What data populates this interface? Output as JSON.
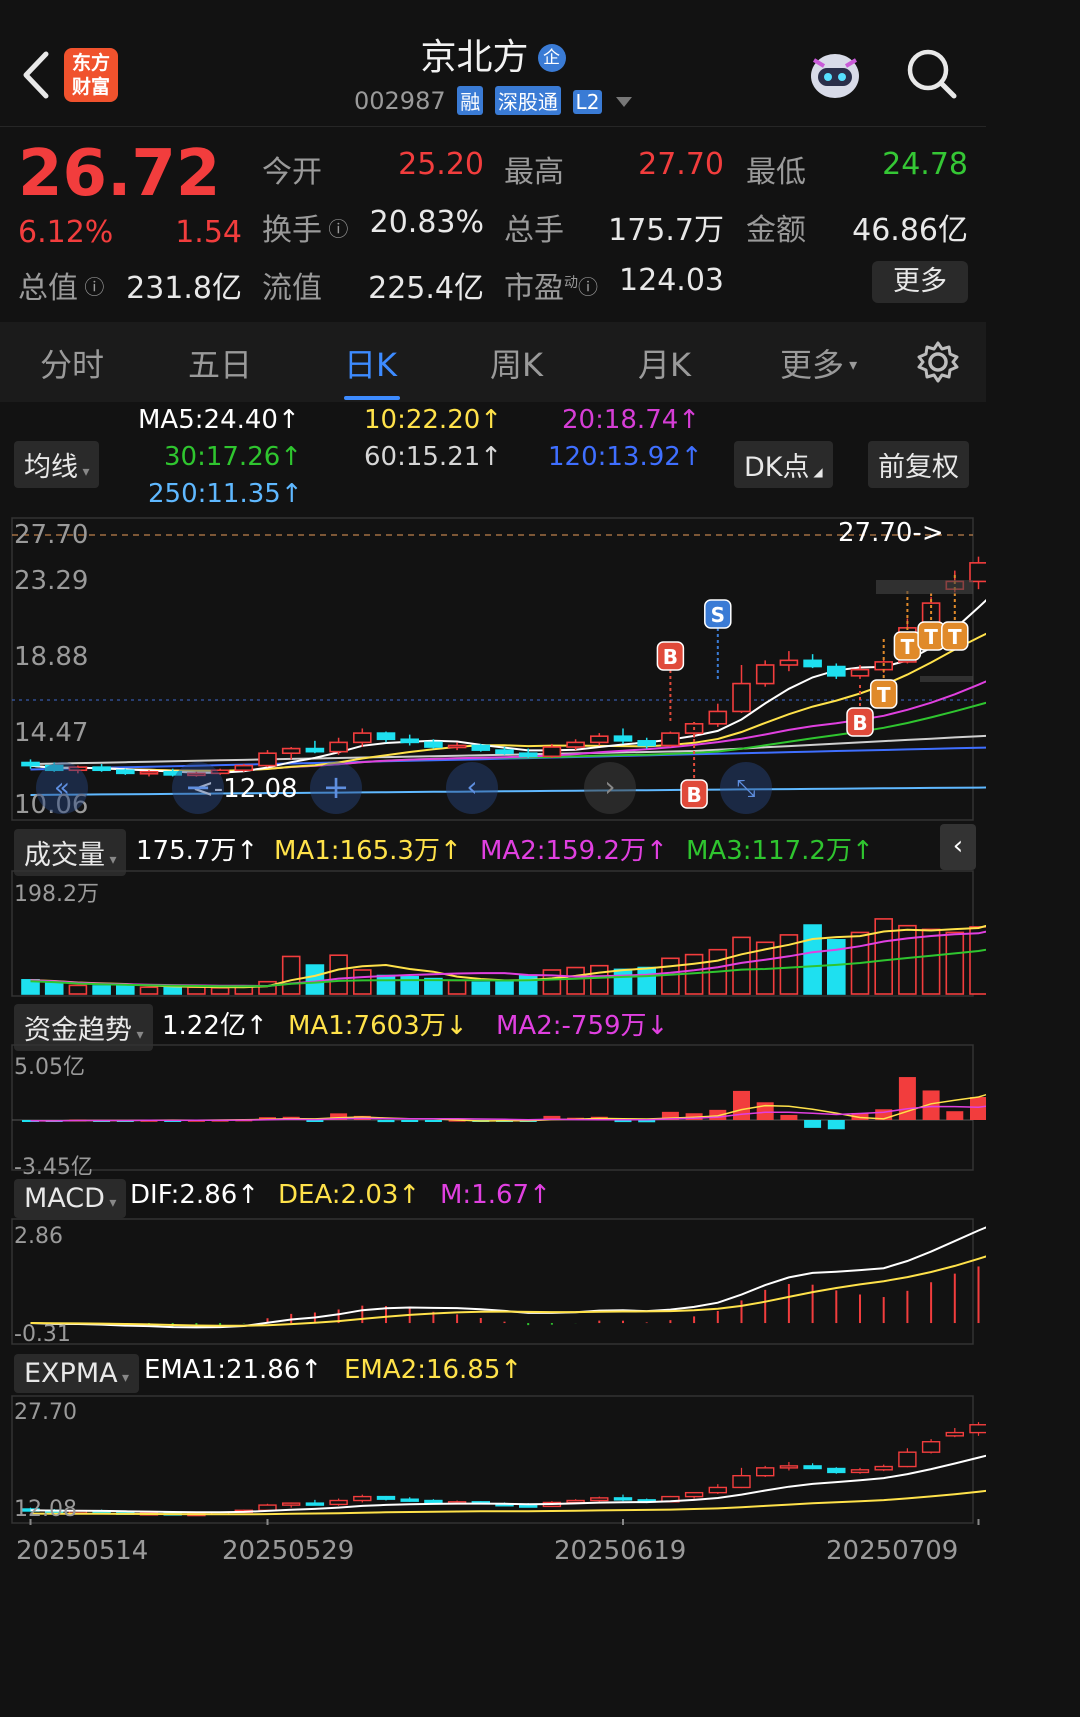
{
  "header": {
    "back_icon": "chevron-left-icon",
    "logo_text_line1": "东方",
    "logo_text_line2": "财富",
    "stock_name": "京北方",
    "company_badge": "企",
    "stock_code": "002987",
    "tags": [
      "融",
      "深股通",
      "L2"
    ],
    "robot_icon": "robot-avatar-icon",
    "search_icon": "search-icon"
  },
  "quote": {
    "price": "26.72",
    "change_pct": "6.12%",
    "change_amt": "1.54",
    "fields": {
      "open_label": "今开",
      "open": "25.20",
      "high_label": "最高",
      "high": "27.70",
      "low_label": "最低",
      "low": "24.78",
      "turnover_label": "换手",
      "turnover": "20.83%",
      "volume_label": "总手",
      "volume": "175.7万",
      "amount_label": "金额",
      "amount": "46.86亿",
      "mcap_label": "总值",
      "mcap": "231.8亿",
      "float_label": "流值",
      "float": "225.4亿",
      "pe_label": "市盈",
      "pe_sup": "动",
      "pe": "124.03"
    },
    "more_button": "更多"
  },
  "tabs": [
    "分时",
    "五日",
    "日K",
    "周K",
    "月K",
    "更多"
  ],
  "active_tab": "日K",
  "kline": {
    "indicator_select": "均线",
    "ma": {
      "ma5": "MA5:24.40↑",
      "ma10": "10:22.20↑",
      "ma20": "20:18.74↑",
      "ma30": "30:17.26↑",
      "ma60": "60:15.21↑",
      "ma120": "120:13.92↑",
      "ma250": "250:11.35↑"
    },
    "dk_button": "DK点",
    "adjust_button": "前复权",
    "yticks": [
      "27.70",
      "23.29",
      "18.88",
      "14.47",
      "10.06"
    ],
    "high_annotation": "27.70->",
    "low_annotation": "<-12.08",
    "markers": [
      "B",
      "S",
      "T"
    ]
  },
  "volume": {
    "label": "成交量",
    "value": "175.7万↑",
    "ma1": "MA1:165.3万↑",
    "ma2": "MA2:159.2万↑",
    "ma3": "MA3:117.2万↑",
    "ytick": "198.2万"
  },
  "fund": {
    "label": "资金趋势",
    "value": "1.22亿↑",
    "ma1": "MA1:7603万↓",
    "ma2": "MA2:-759万↓",
    "ytick_top": "5.05亿",
    "ytick_bottom": "-3.45亿"
  },
  "macd": {
    "label": "MACD",
    "dif": "DIF:2.86↑",
    "dea": "DEA:2.03↑",
    "m": "M:1.67↑",
    "ytick_top": "2.86",
    "ytick_bottom": "-0.31"
  },
  "expma": {
    "label": "EXPMA",
    "ema1": "EMA1:21.86↑",
    "ema2": "EMA2:16.85↑",
    "ytick_top": "27.70",
    "ytick_bottom": "12.08"
  },
  "dates": [
    "20250514",
    "20250529",
    "20250619",
    "20250709"
  ],
  "colors": {
    "up": "#f23d3d",
    "down": "#1ee0f0",
    "ma5": "#ffffff",
    "ma10": "#ffe24a",
    "ma20": "#e040e0",
    "ma30": "#2fc52f",
    "ma60": "#cfcfcf",
    "ma120": "#3f6fff",
    "ma250": "#5fb8ff",
    "accent": "#3d8bff"
  },
  "chart_data": {
    "type": "candlestick",
    "title": "",
    "note": "Daily K-line (approximate OHLC read from chart, data units = price)",
    "ylim": [
      10.06,
      27.7
    ],
    "candles": [
      {
        "o": 13.0,
        "h": 13.2,
        "l": 12.6,
        "c": 12.8
      },
      {
        "o": 12.8,
        "h": 13.0,
        "l": 12.4,
        "c": 12.5
      },
      {
        "o": 12.5,
        "h": 12.8,
        "l": 12.3,
        "c": 12.7
      },
      {
        "o": 12.7,
        "h": 12.9,
        "l": 12.4,
        "c": 12.5
      },
      {
        "o": 12.5,
        "h": 12.6,
        "l": 12.2,
        "c": 12.3
      },
      {
        "o": 12.3,
        "h": 12.5,
        "l": 12.1,
        "c": 12.4
      },
      {
        "o": 12.4,
        "h": 12.6,
        "l": 12.1,
        "c": 12.2
      },
      {
        "o": 12.2,
        "h": 12.4,
        "l": 12.08,
        "c": 12.3
      },
      {
        "o": 12.3,
        "h": 12.6,
        "l": 12.2,
        "c": 12.5
      },
      {
        "o": 12.5,
        "h": 12.9,
        "l": 12.4,
        "c": 12.8
      },
      {
        "o": 12.8,
        "h": 13.8,
        "l": 12.7,
        "c": 13.6
      },
      {
        "o": 13.6,
        "h": 14.0,
        "l": 13.2,
        "c": 13.9
      },
      {
        "o": 13.9,
        "h": 14.4,
        "l": 13.6,
        "c": 13.7
      },
      {
        "o": 13.7,
        "h": 14.6,
        "l": 13.5,
        "c": 14.3
      },
      {
        "o": 14.3,
        "h": 15.2,
        "l": 14.0,
        "c": 14.9
      },
      {
        "o": 14.9,
        "h": 15.0,
        "l": 14.3,
        "c": 14.5
      },
      {
        "o": 14.5,
        "h": 14.8,
        "l": 14.1,
        "c": 14.3
      },
      {
        "o": 14.3,
        "h": 14.5,
        "l": 13.9,
        "c": 14.0
      },
      {
        "o": 14.0,
        "h": 14.3,
        "l": 13.8,
        "c": 14.1
      },
      {
        "o": 14.1,
        "h": 14.2,
        "l": 13.7,
        "c": 13.8
      },
      {
        "o": 13.8,
        "h": 14.0,
        "l": 13.5,
        "c": 13.6
      },
      {
        "o": 13.6,
        "h": 13.9,
        "l": 13.3,
        "c": 13.4
      },
      {
        "o": 13.4,
        "h": 14.2,
        "l": 13.3,
        "c": 14.0
      },
      {
        "o": 14.0,
        "h": 14.5,
        "l": 13.8,
        "c": 14.3
      },
      {
        "o": 14.3,
        "h": 14.9,
        "l": 14.1,
        "c": 14.7
      },
      {
        "o": 14.7,
        "h": 15.2,
        "l": 14.2,
        "c": 14.4
      },
      {
        "o": 14.4,
        "h": 14.6,
        "l": 13.9,
        "c": 14.1
      },
      {
        "o": 14.1,
        "h": 15.0,
        "l": 14.0,
        "c": 14.9
      },
      {
        "o": 14.9,
        "h": 15.6,
        "l": 14.6,
        "c": 15.5
      },
      {
        "o": 15.5,
        "h": 16.8,
        "l": 15.3,
        "c": 16.3
      },
      {
        "o": 16.3,
        "h": 19.3,
        "l": 16.2,
        "c": 18.1
      },
      {
        "o": 18.1,
        "h": 19.6,
        "l": 17.9,
        "c": 19.3
      },
      {
        "o": 19.3,
        "h": 20.2,
        "l": 18.9,
        "c": 19.6
      },
      {
        "o": 19.6,
        "h": 20.0,
        "l": 19.1,
        "c": 19.2
      },
      {
        "o": 19.2,
        "h": 19.4,
        "l": 18.4,
        "c": 18.6
      },
      {
        "o": 18.6,
        "h": 19.3,
        "l": 18.4,
        "c": 19.0
      },
      {
        "o": 19.0,
        "h": 19.8,
        "l": 18.8,
        "c": 19.5
      },
      {
        "o": 19.5,
        "h": 22.3,
        "l": 19.4,
        "c": 21.7
      },
      {
        "o": 21.7,
        "h": 23.7,
        "l": 21.5,
        "c": 23.3
      },
      {
        "o": 24.2,
        "h": 25.4,
        "l": 24.0,
        "c": 24.7
      },
      {
        "o": 24.7,
        "h": 26.3,
        "l": 24.2,
        "c": 25.9
      },
      {
        "o": 25.2,
        "h": 27.7,
        "l": 24.78,
        "c": 26.72
      }
    ],
    "volume": [
      23,
      20,
      14,
      13,
      13,
      11,
      12,
      11,
      10,
      12,
      20,
      61,
      47,
      63,
      39,
      30,
      28,
      25,
      22,
      19,
      19,
      30,
      39,
      43,
      46,
      40,
      43,
      58,
      64,
      72,
      92,
      84,
      96,
      112,
      88,
      100,
      122,
      111,
      105,
      100,
      109,
      175.7
    ]
  }
}
